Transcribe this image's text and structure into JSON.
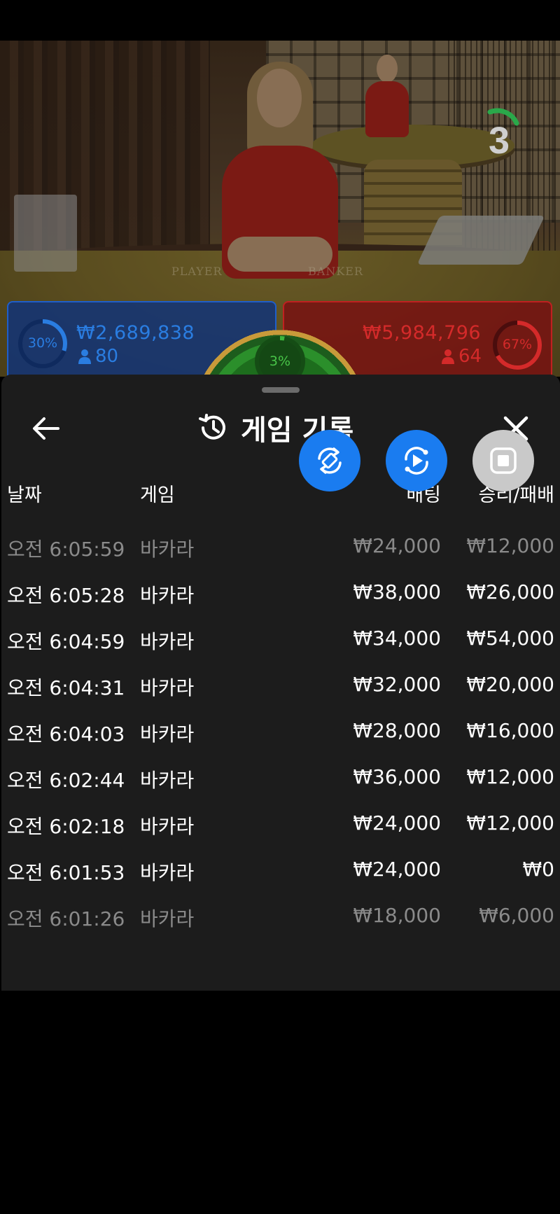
{
  "video": {
    "felt_left": "PLAYER",
    "felt_right": "BANKER",
    "countdown": "3"
  },
  "bet_bar": {
    "player": {
      "percent": "30%",
      "percent_value": 0.3,
      "amount": "₩2,689,838",
      "count": "80",
      "color": "#2a7de1"
    },
    "tie": {
      "percent": "3%",
      "percent_value": 0.03,
      "color": "#3cb53c"
    },
    "banker": {
      "percent": "67%",
      "percent_value": 0.67,
      "amount": "₩5,984,796",
      "count": "64",
      "color": "#d42a2a"
    }
  },
  "sheet": {
    "title": "게임 기록",
    "columns": {
      "date": "날짜",
      "game": "게임",
      "bet": "배팅",
      "result": "승리/패배"
    },
    "rows": [
      {
        "date": "오전 6:05:59",
        "game": "바카라",
        "bet": "₩24,000",
        "result": "₩12,000"
      },
      {
        "date": "오전 6:05:28",
        "game": "바카라",
        "bet": "₩38,000",
        "result": "₩26,000"
      },
      {
        "date": "오전 6:04:59",
        "game": "바카라",
        "bet": "₩34,000",
        "result": "₩54,000"
      },
      {
        "date": "오전 6:04:31",
        "game": "바카라",
        "bet": "₩32,000",
        "result": "₩20,000"
      },
      {
        "date": "오전 6:04:03",
        "game": "바카라",
        "bet": "₩28,000",
        "result": "₩16,000"
      },
      {
        "date": "오전 6:02:44",
        "game": "바카라",
        "bet": "₩36,000",
        "result": "₩12,000"
      },
      {
        "date": "오전 6:02:18",
        "game": "바카라",
        "bet": "₩24,000",
        "result": "₩12,000"
      },
      {
        "date": "오전 6:01:53",
        "game": "바카라",
        "bet": "₩24,000",
        "result": "₩0"
      },
      {
        "date": "오전 6:01:26",
        "game": "바카라",
        "bet": "₩18,000",
        "result": "₩6,000"
      }
    ]
  },
  "controls": {
    "icons": [
      "rotate-screen-icon",
      "replay-play-icon",
      "stop-icon"
    ],
    "accent": "#1a7cf0"
  }
}
